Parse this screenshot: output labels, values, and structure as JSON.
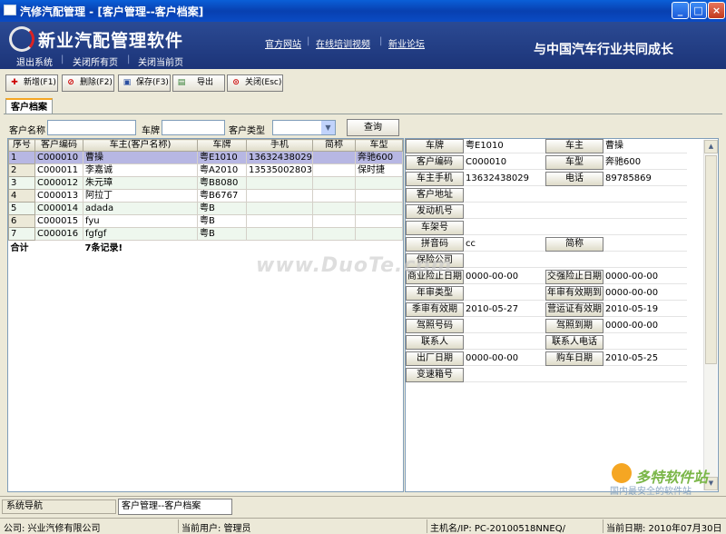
{
  "window": {
    "title": "汽修汽配管理 - [客户管理--客户档案]",
    "min": "_",
    "max": "□",
    "close": "×"
  },
  "banner": {
    "brand": "新业汽配管理软件",
    "links_left": [
      "退出系统",
      "关闭所有页",
      "关闭当前页"
    ],
    "links_top": [
      "官方网站",
      "在线培训视频",
      "新业论坛"
    ],
    "slogan": "与中国汽车行业共同成长"
  },
  "toolbar": {
    "add": "新增(F1)",
    "delete": "删除(F2)",
    "save": "保存(F3)",
    "export": "导出",
    "close": "关闭(Esc)"
  },
  "tab": {
    "label": "客户档案"
  },
  "search": {
    "name_label": "客户名称",
    "plate_label": "车牌",
    "type_label": "客户类型",
    "name_value": "",
    "plate_value": "",
    "type_value": "",
    "query": "查询"
  },
  "grid": {
    "columns": [
      "序号",
      "客户编码",
      "车主(客户名称)",
      "车牌",
      "手机",
      "简称",
      "车型"
    ],
    "rows": [
      [
        "1",
        "C000010",
        "曹操",
        "粤E1010",
        "13632438029",
        "",
        "奔驰600"
      ],
      [
        "2",
        "C000011",
        "李嘉诚",
        "粤A2010",
        "13535002803",
        "",
        "保时捷"
      ],
      [
        "3",
        "C000012",
        "朱元璋",
        "粤B8080",
        "",
        "",
        ""
      ],
      [
        "4",
        "C000013",
        "阿拉丁",
        "粤B6767",
        "",
        "",
        ""
      ],
      [
        "5",
        "C000014",
        "adada",
        "粤B",
        "",
        "",
        ""
      ],
      [
        "6",
        "C000015",
        "fyu",
        "粤B",
        "",
        "",
        ""
      ],
      [
        "7",
        "C000016",
        "fgfgf",
        "粤B",
        "",
        "",
        ""
      ]
    ],
    "total_label": "合计",
    "total_count": "7条记录!"
  },
  "detail": {
    "plate": {
      "label": "车牌",
      "value": "粤E1010"
    },
    "owner": {
      "label": "车主",
      "value": "曹操"
    },
    "code": {
      "label": "客户编码",
      "value": "C000010"
    },
    "model": {
      "label": "车型",
      "value": "奔驰600"
    },
    "mobile": {
      "label": "车主手机",
      "value": "13632438029"
    },
    "phone": {
      "label": "电话",
      "value": "89785869"
    },
    "address": {
      "label": "客户地址",
      "value": ""
    },
    "engine": {
      "label": "发动机号",
      "value": ""
    },
    "frame": {
      "label": "车架号",
      "value": ""
    },
    "pinyin": {
      "label": "拼音码",
      "value": "cc"
    },
    "abbr": {
      "label": "简称",
      "value": ""
    },
    "insurer": {
      "label": "保险公司",
      "value": ""
    },
    "comm_ins": {
      "label": "商业险止日期",
      "value": "0000-00-00"
    },
    "comp_ins": {
      "label": "交强险止日期",
      "value": "0000-00-00"
    },
    "inspect_type": {
      "label": "年审类型",
      "value": ""
    },
    "inspect_valid": {
      "label": "年审有效期到",
      "value": "0000-00-00"
    },
    "season_valid": {
      "label": "季审有效期",
      "value": "2010-05-27"
    },
    "operate_valid": {
      "label": "营运证有效期",
      "value": "2010-05-19"
    },
    "license_no": {
      "label": "驾照号码",
      "value": ""
    },
    "license_exp": {
      "label": "驾照到期",
      "value": "0000-00-00"
    },
    "contact": {
      "label": "联系人",
      "value": ""
    },
    "contact_phone": {
      "label": "联系人电话",
      "value": ""
    },
    "factory_date": {
      "label": "出厂日期",
      "value": "0000-00-00"
    },
    "purchase_date": {
      "label": "购车日期",
      "value": "2010-05-25"
    },
    "gearbox": {
      "label": "变速箱号",
      "value": ""
    }
  },
  "watermark": {
    "center": "www.DuoTe.com",
    "corner_brand": "多特软件站",
    "corner_sub": "国内最安全的软件站"
  },
  "nav": {
    "panel": "系统导航",
    "current": "客户管理--客户档案"
  },
  "status": {
    "company": "公司: 兴业汽修有限公司",
    "user": "当前用户: 管理员",
    "host": "主机名/IP: PC-20100518NNEQ/",
    "date": "当前日期: 2010年07月30日"
  },
  "colors": {
    "titlebar": "#0840b0",
    "banner": "#1c3478",
    "selected_row": "#b7b7e3",
    "alt_row": "#eef7ee"
  }
}
